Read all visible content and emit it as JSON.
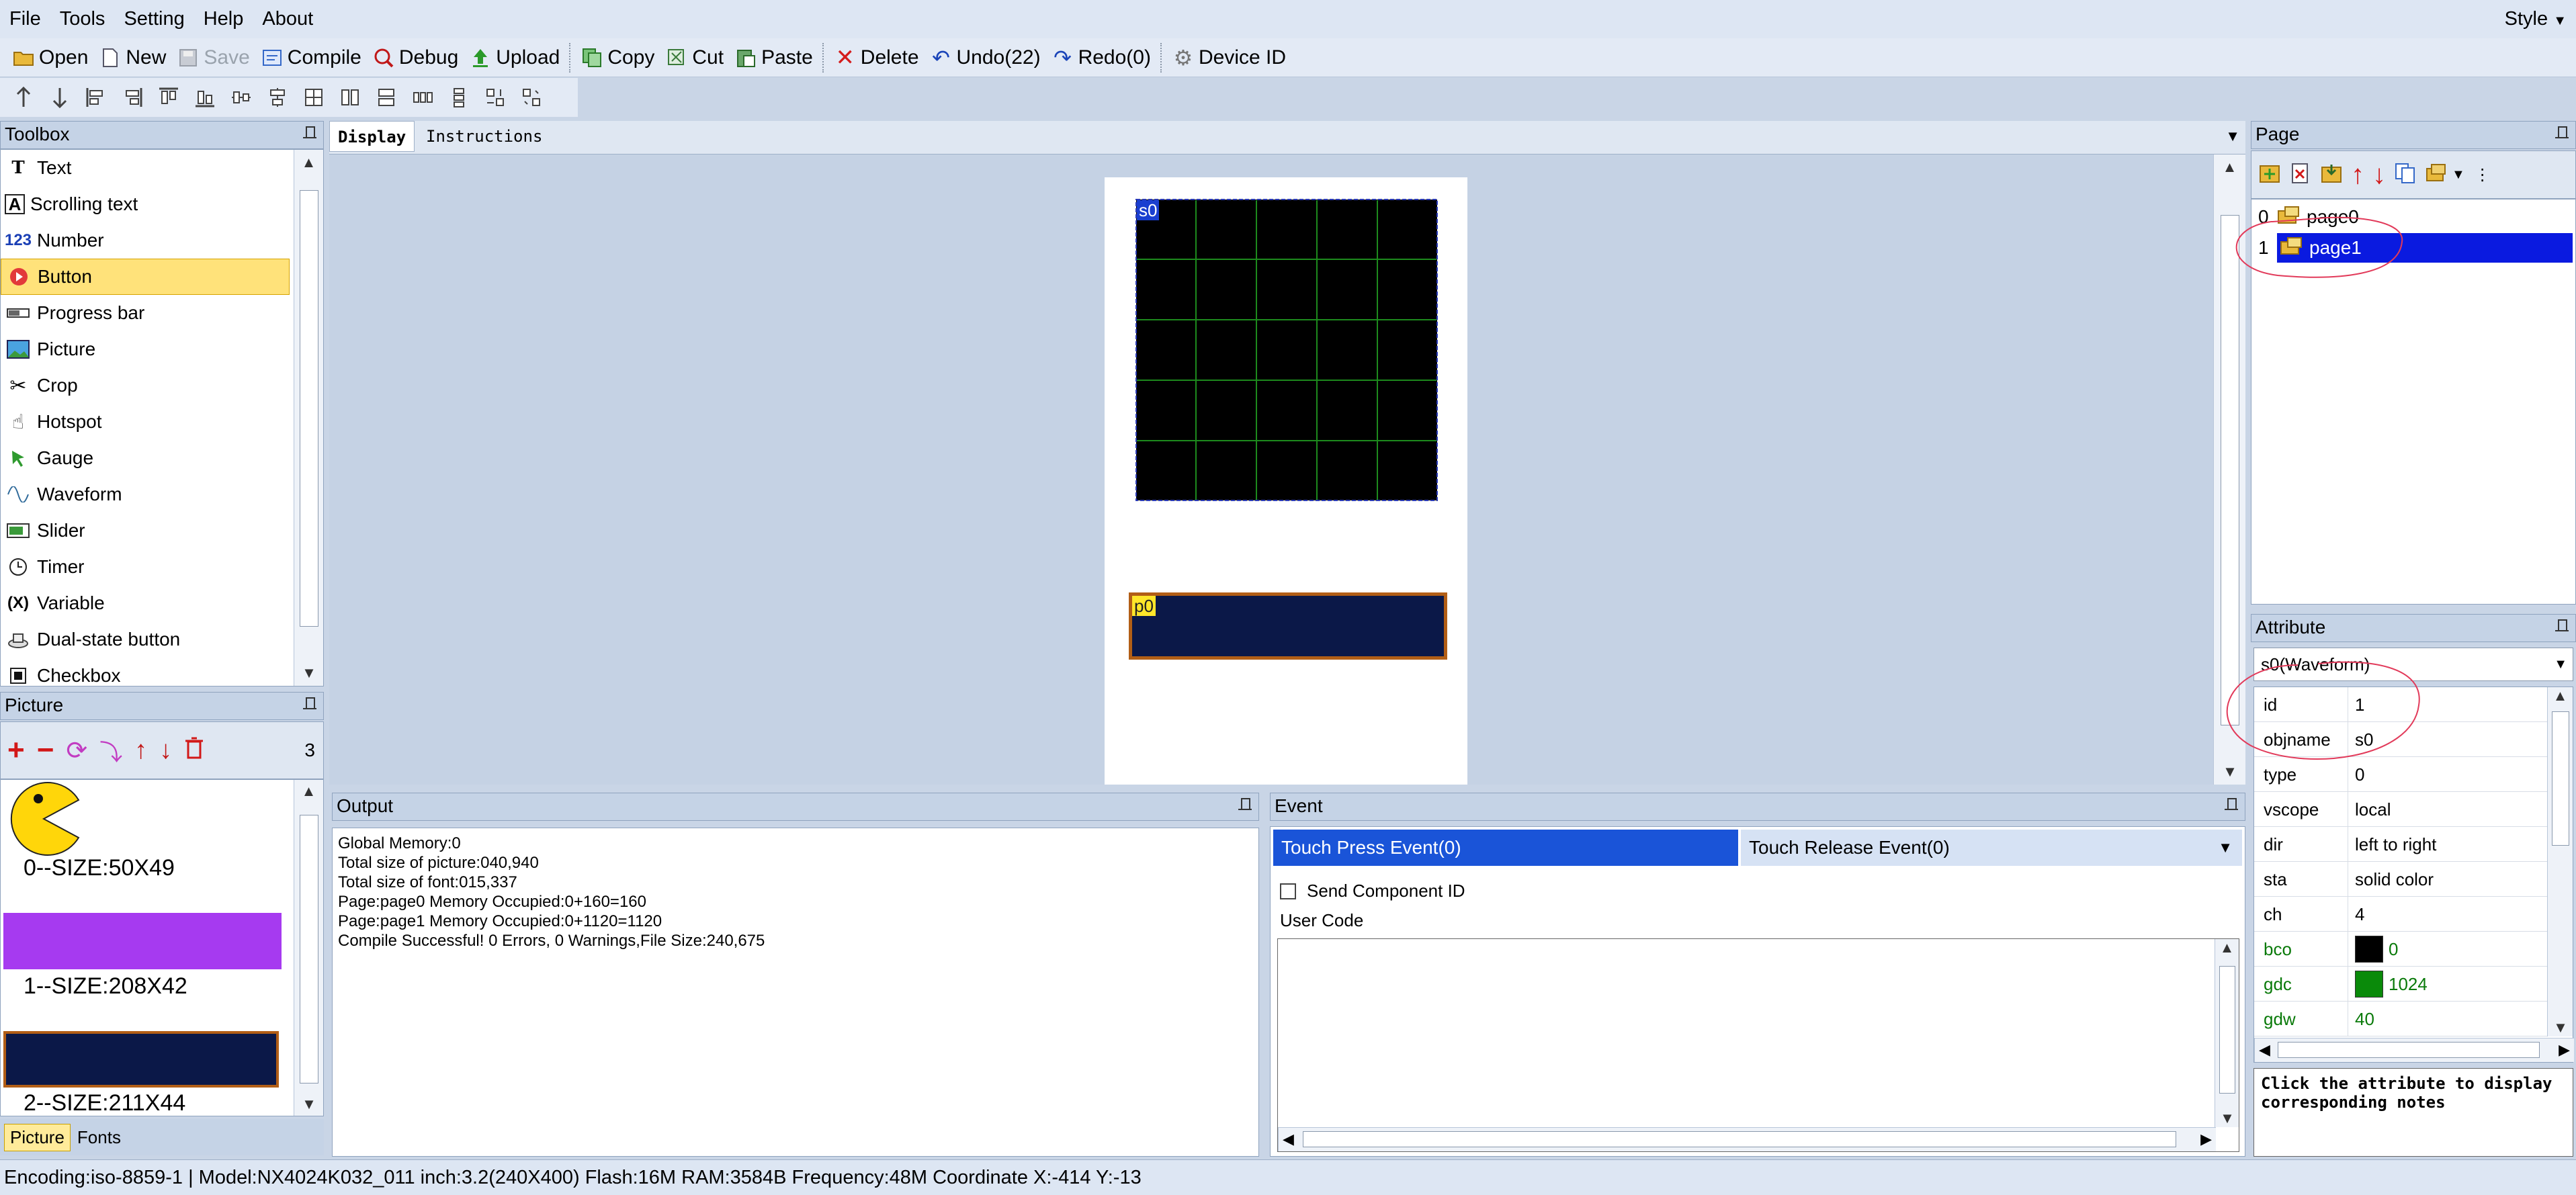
{
  "menu": {
    "items": [
      "File",
      "Tools",
      "Setting",
      "Help",
      "About"
    ],
    "style": "Style"
  },
  "toolbar": {
    "open": "Open",
    "new": "New",
    "save": "Save",
    "compile": "Compile",
    "debug": "Debug",
    "upload": "Upload",
    "copy": "Copy",
    "cut": "Cut",
    "paste": "Paste",
    "delete": "Delete",
    "undo": "Undo(22)",
    "redo": "Redo(0)",
    "device_id": "Device  ID"
  },
  "toolbox": {
    "title": "Toolbox",
    "items": [
      "Text",
      "Scrolling text",
      "Number",
      "Button",
      "Progress bar",
      "Picture",
      "Crop",
      "Hotspot",
      "Gauge",
      "Waveform",
      "Slider",
      "Timer",
      "Variable",
      "Dual-state button",
      "Checkbox"
    ],
    "selected": "Button"
  },
  "picture_panel": {
    "title": "Picture",
    "count": "3",
    "items": [
      {
        "label": "0--SIZE:50X49"
      },
      {
        "label": "1--SIZE:208X42"
      },
      {
        "label": "2--SIZE:211X44"
      }
    ],
    "tabs": [
      "Picture",
      "Fonts"
    ]
  },
  "canvas": {
    "tabs": [
      "Display",
      "Instructions"
    ],
    "waveform_label": "s0",
    "progress_label": "p0"
  },
  "output": {
    "title": "Output",
    "lines": [
      "Global Memory:0",
      "Total size of picture:040,940",
      "Total size of font:015,337",
      "Page:page0 Memory Occupied:0+160=160",
      "Page:page1 Memory Occupied:0+1120=1120",
      "Compile Successful! 0 Errors, 0 Warnings,File Size:240,675"
    ]
  },
  "event": {
    "title": "Event",
    "tab_press": "Touch Press Event(0)",
    "tab_release": "Touch Release Event(0)",
    "send_component_id": "Send Component ID",
    "user_code": "User Code"
  },
  "page_panel": {
    "title": "Page",
    "pages": [
      {
        "index": "0",
        "name": "page0"
      },
      {
        "index": "1",
        "name": "page1"
      }
    ]
  },
  "attribute": {
    "title": "Attribute",
    "selected": "s0(Waveform)",
    "rows": [
      {
        "key": "id",
        "value": "1"
      },
      {
        "key": "objname",
        "value": "s0"
      },
      {
        "key": "type",
        "value": "0"
      },
      {
        "key": "vscope",
        "value": "local"
      },
      {
        "key": "dir",
        "value": "left to right"
      },
      {
        "key": "sta",
        "value": "solid color"
      },
      {
        "key": "ch",
        "value": "4"
      },
      {
        "key": "bco",
        "value": "0"
      },
      {
        "key": "gdc",
        "value": "1024"
      },
      {
        "key": "gdw",
        "value": "40"
      }
    ],
    "note": "Click the attribute to display corresponding notes"
  },
  "status": {
    "text": "Encoding:iso-8859-1 | Model:NX4024K032_011  inch:3.2(240X400) Flash:16M RAM:3584B Frequency:48M     Coordinate X:-414  Y:-13"
  },
  "colors": {
    "accent": "#1a54d8",
    "selection": "#0a1ae0",
    "highlight": "#ffe27a",
    "navy": "#0b1848",
    "grid": "#1d8a1d"
  }
}
